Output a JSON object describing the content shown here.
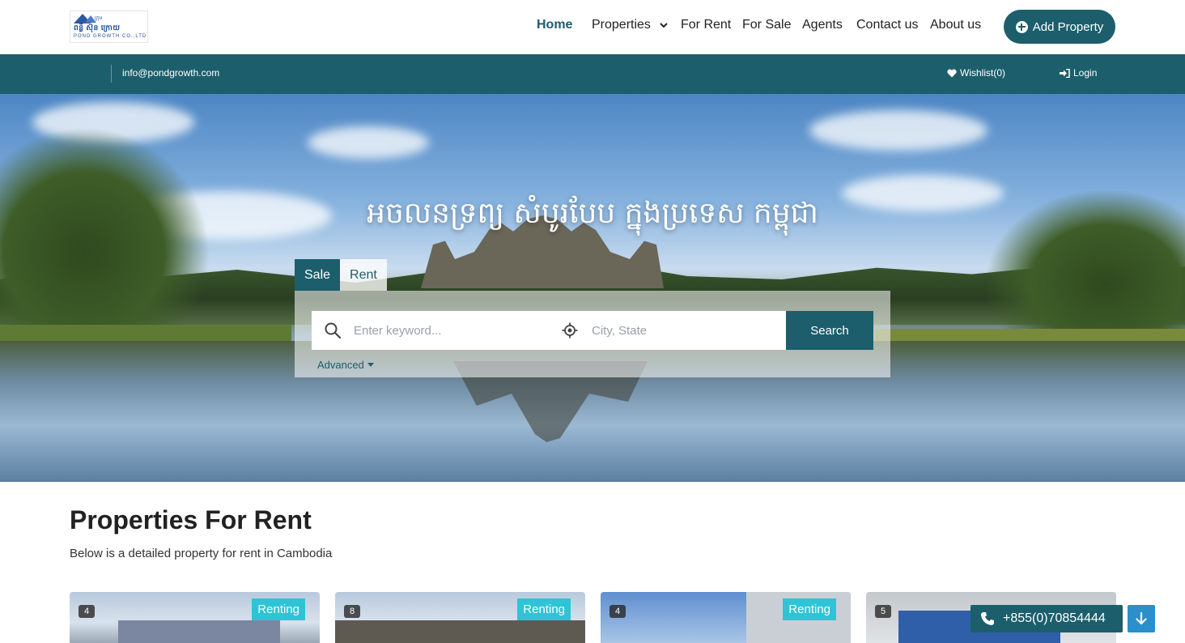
{
  "logo": {
    "line0": "ក្រុម",
    "line1": "ពន្លឺ ស៊ុន ក្រោយ",
    "line2": "POND GROWTH CO.,LTD"
  },
  "nav": {
    "home": "Home",
    "properties": "Properties",
    "for_rent": "For Rent",
    "for_sale": "For Sale",
    "agents": "Agents",
    "contact": "Contact us",
    "about": "About us",
    "add_property": "Add Property"
  },
  "topbar": {
    "email": "info@pondgrowth.com",
    "wishlist": "Wishlist(0)",
    "login": "Login"
  },
  "hero": {
    "title": "អចលនទ្រព្យ សំបូរបែប ក្នុងប្រទេស កម្ពុជា",
    "tabs": [
      "Sale",
      "Rent"
    ],
    "keyword_placeholder": "Enter keyword...",
    "city_placeholder": "City, State",
    "search_label": "Search",
    "advanced_label": "Advanced"
  },
  "section": {
    "title": "Properties For Rent",
    "subtitle": "Below is a detailed property for rent in Cambodia"
  },
  "cards": [
    {
      "photos": "4",
      "status": "Renting"
    },
    {
      "photos": "8",
      "status": "Renting"
    },
    {
      "photos": "4",
      "status": "Renting"
    },
    {
      "photos": "5",
      "status": ""
    }
  ],
  "floating": {
    "phone": "+855(0)70854444"
  },
  "colors": {
    "brand": "#1c5e6c",
    "badge": "#2ec4d6",
    "scroll_btn": "#2a8fcb"
  }
}
